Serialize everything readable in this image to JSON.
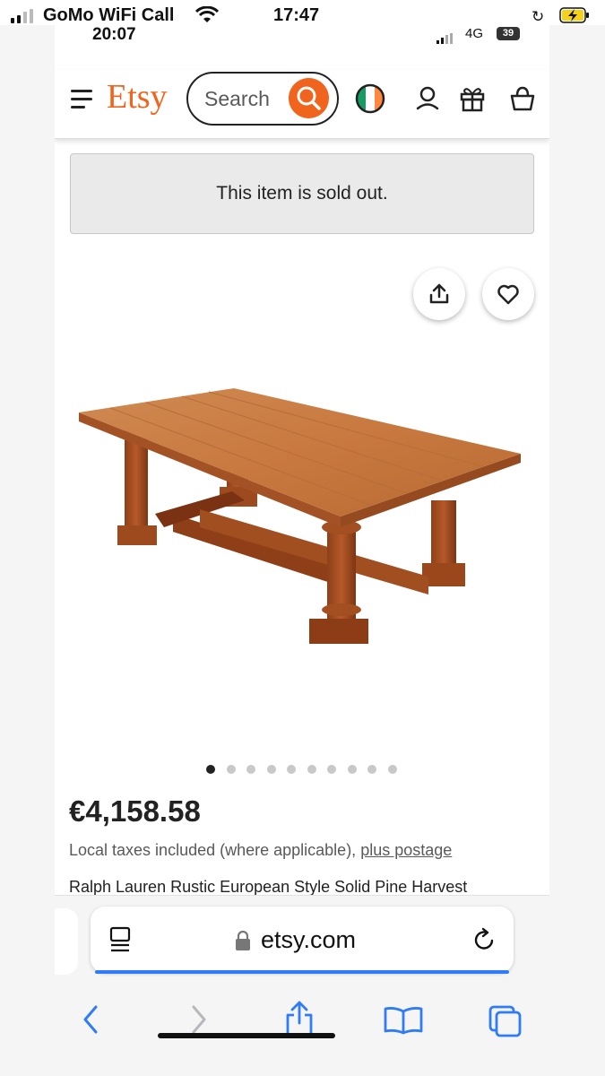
{
  "outer_status": {
    "carrier": "GoMo WiFi Call",
    "time": "17:47"
  },
  "inner_status": {
    "time": "20:07",
    "network": "4G",
    "battery": "39"
  },
  "header": {
    "logo": "Etsy",
    "search_placeholder": "Search",
    "icons": [
      "menu-icon",
      "search-icon",
      "ireland-flag-icon",
      "account-icon",
      "gift-icon",
      "cart-icon"
    ]
  },
  "notice": {
    "sold_out": "This item is sold out."
  },
  "carousel": {
    "image_alt": "pine harvest table",
    "active_index": 0,
    "total": 10
  },
  "listing": {
    "price": "€4,158.58",
    "tax_note": "Local taxes included (where applicable), ",
    "postage_link": "plus postage",
    "title": "Ralph Lauren Rustic European Style Solid Pine Harvest"
  },
  "browser": {
    "url": "etsy.com",
    "toolbar": [
      "back-icon",
      "forward-icon",
      "share-icon",
      "bookmarks-icon",
      "tabs-icon"
    ]
  },
  "colors": {
    "brand": "#f1641e",
    "accent_blue": "#2f7cf6"
  }
}
